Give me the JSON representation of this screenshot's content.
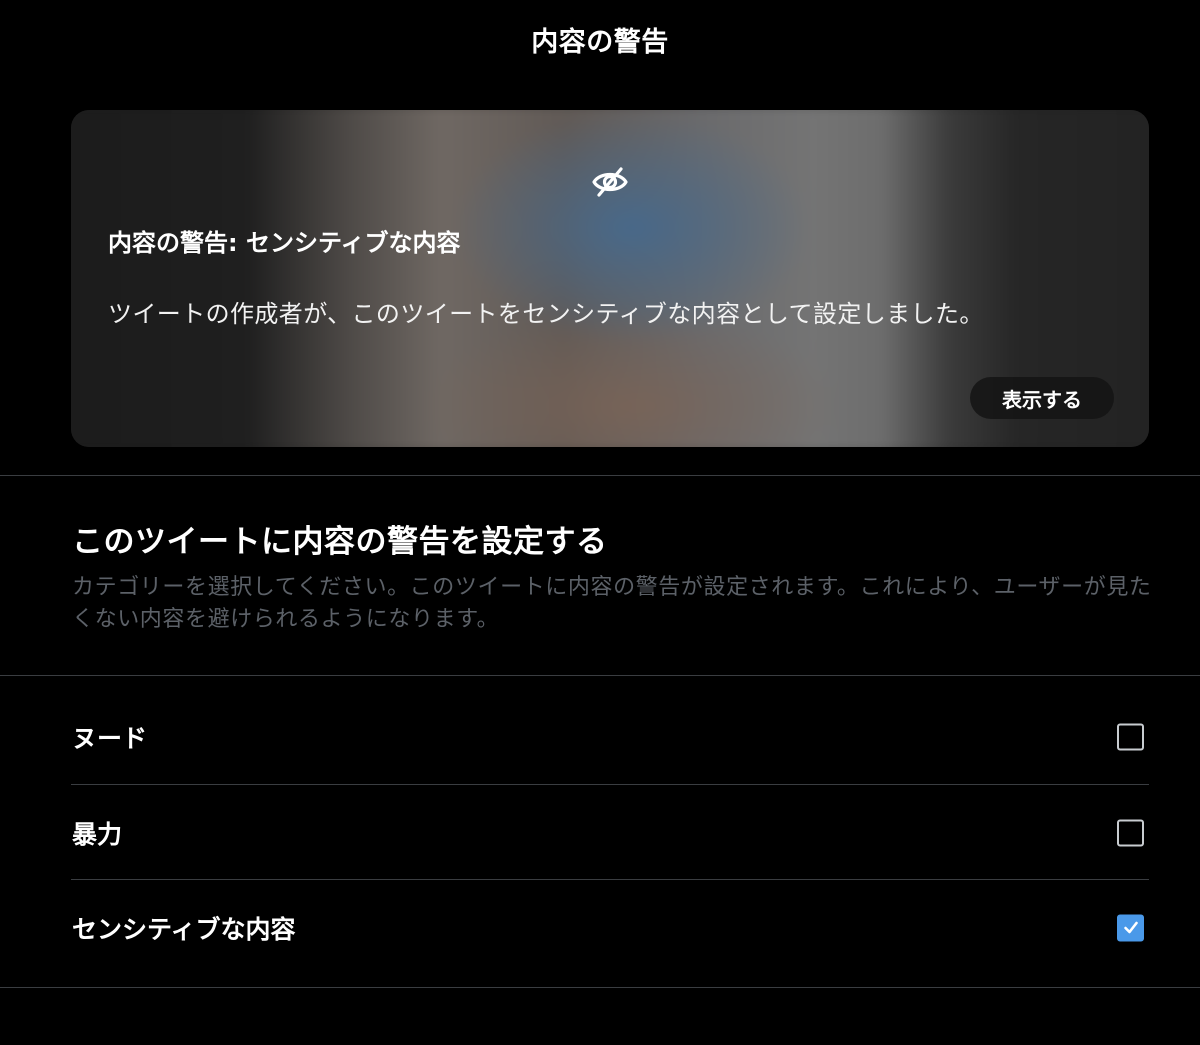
{
  "header": {
    "title": "内容の警告"
  },
  "warning_card": {
    "title": "内容の警告: センシティブな内容",
    "description": "ツイートの作成者が、このツイートをセンシティブな内容として設定しました。",
    "show_button_label": "表示する",
    "icon": "eye-slash-icon"
  },
  "settings_section": {
    "title": "このツイートに内容の警告を設定する",
    "description": "カテゴリーを選択してください。このツイートに内容の警告が設定されます。これにより、ユーザーが見たくない内容を避けられるようになります。"
  },
  "options": [
    {
      "label": "ヌード",
      "checked": false
    },
    {
      "label": "暴力",
      "checked": false
    },
    {
      "label": "センシティブな内容",
      "checked": true
    }
  ],
  "colors": {
    "accent": "#4a99e9",
    "background": "#000000",
    "divider": "#3a3d41",
    "muted_text": "#5c6168"
  }
}
